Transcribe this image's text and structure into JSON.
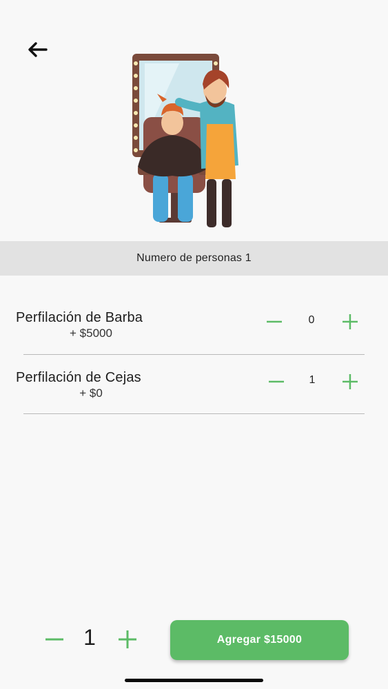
{
  "header": {
    "back_icon": "arrow-left-icon"
  },
  "hero": {
    "illustration": "barber-cutting-hair-illustration"
  },
  "persons_band": {
    "label": "Numero de personas 1"
  },
  "services": [
    {
      "name": "Perfilación de Barba",
      "price": "+ $5000",
      "quantity": "0"
    },
    {
      "name": "Perfilación de Cejas",
      "price": "+ $0",
      "quantity": "1"
    }
  ],
  "footer": {
    "people_count": "1",
    "add_button_label": "Agregar $15000"
  },
  "colors": {
    "accent": "#5cbb66",
    "band": "#e2e2e2",
    "background": "#f8f8f8"
  }
}
